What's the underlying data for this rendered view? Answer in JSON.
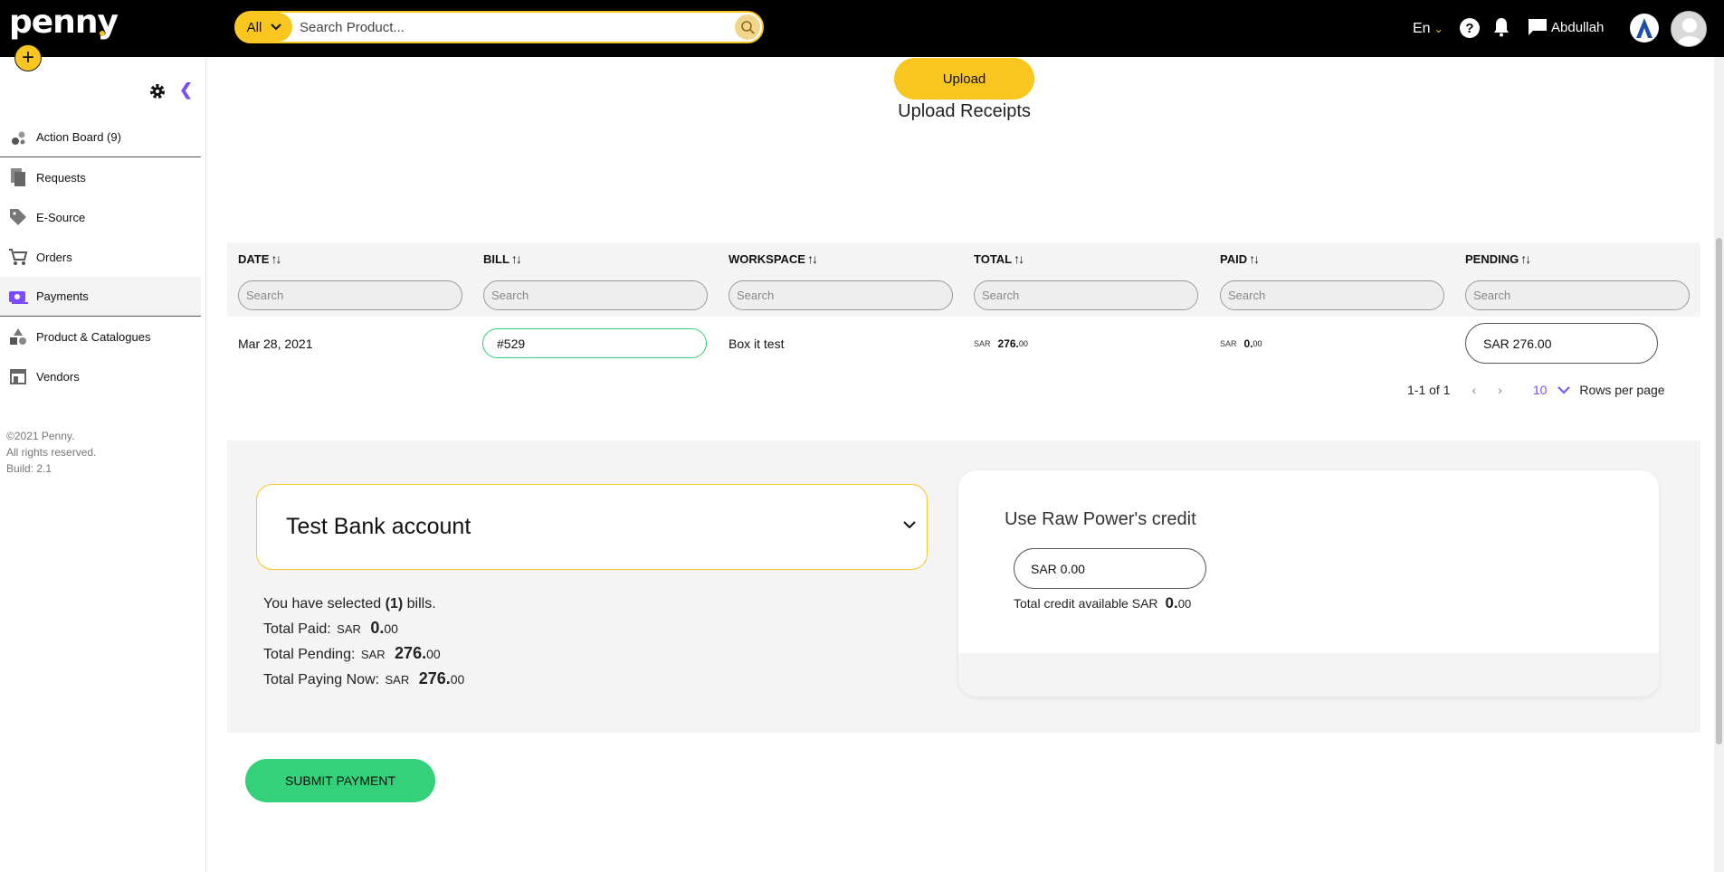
{
  "app": {
    "logo": "penny"
  },
  "topbar": {
    "search_category": "All",
    "search_placeholder": "Search Product...",
    "language": "En",
    "username": "Abdullah"
  },
  "sidebar": {
    "items": [
      {
        "label": "Action Board (9)",
        "icon": "action-board-icon"
      },
      {
        "label": "Requests",
        "icon": "requests-icon"
      },
      {
        "label": "E-Source",
        "icon": "tag-icon"
      },
      {
        "label": "Orders",
        "icon": "cart-icon"
      },
      {
        "label": "Payments",
        "icon": "payments-icon"
      },
      {
        "label": "Product & Catalogues",
        "icon": "shapes-icon"
      },
      {
        "label": "Vendors",
        "icon": "store-icon"
      }
    ],
    "copyright": [
      "©2021 Penny.",
      "All rights reserved.",
      "Build: 2.1"
    ]
  },
  "upload": {
    "button_label": "Upload",
    "title": "Upload Receipts"
  },
  "table": {
    "columns": [
      "DATE",
      "BILL",
      "WORKSPACE",
      "TOTAL",
      "PAID",
      "PENDING"
    ],
    "filter_placeholder": "Search",
    "rows": [
      {
        "date": "Mar 28, 2021",
        "bill": "#529",
        "workspace": "Box it test",
        "total_currency": "SAR",
        "total_int": "276.",
        "total_dec": "00",
        "paid_currency": "SAR",
        "paid_int": "0.",
        "paid_dec": "00",
        "pending": "SAR 276.00"
      }
    ],
    "pagination": {
      "range": "1-1 of 1",
      "rows_per_page_value": "10",
      "rows_per_page_label": "Rows per page"
    }
  },
  "payment": {
    "bank_account": "Test Bank account",
    "selected_prefix": "You have selected ",
    "selected_count": "(1)",
    "selected_suffix": " bills.",
    "total_paid_label": "Total Paid:",
    "total_paid_currency": "SAR",
    "total_paid_int": "0.",
    "total_paid_dec": "00",
    "total_pending_label": "Total Pending:",
    "total_pending_currency": "SAR",
    "total_pending_int": "276.",
    "total_pending_dec": "00",
    "total_paying_label": "Total Paying Now:",
    "total_paying_currency": "SAR",
    "total_paying_int": "276.",
    "total_paying_dec": "00",
    "credit_title": "Use Raw Power's credit",
    "credit_value": "SAR 0.00",
    "credit_available_label": "Total credit available SAR",
    "credit_available_int": "0.",
    "credit_available_dec": "00",
    "submit_label": "SUBMIT PAYMENT"
  },
  "colors": {
    "brand_yellow": "#f9c51f",
    "accent_purple": "#7b4cff",
    "submit_green": "#33d17a",
    "bill_border_green": "#2ecc71"
  }
}
